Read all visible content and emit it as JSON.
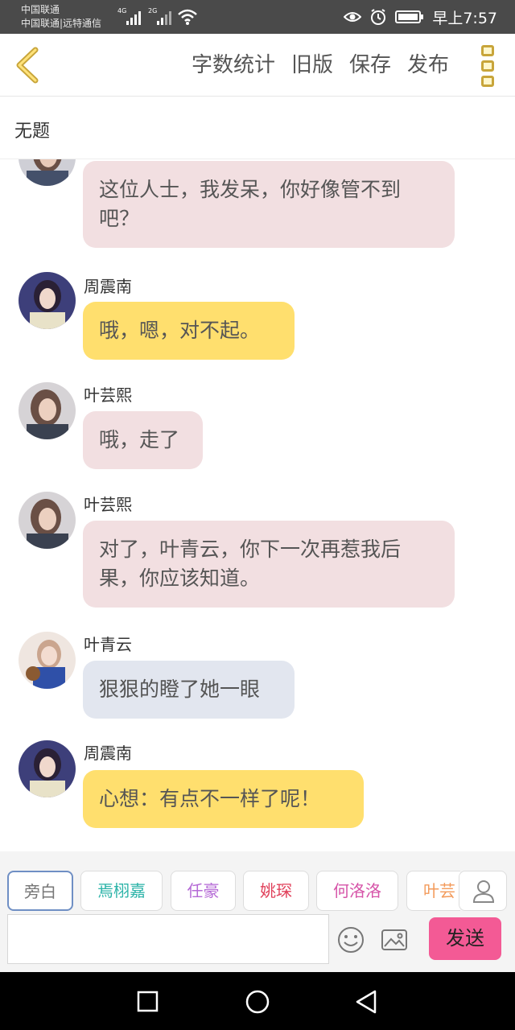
{
  "status_bar": {
    "carrier_line1": "中国联通",
    "carrier_line2": "中国联通|远特通信",
    "network1": "4G",
    "network2": "2G",
    "time": "早上7:57"
  },
  "top_bar": {
    "word_count": "字数统计",
    "old_version": "旧版",
    "save": "保存",
    "publish": "发布"
  },
  "title": "无题",
  "messages": [
    {
      "speaker": "",
      "text": "这位人士，我发呆，你好像管不到吧？",
      "color": "#f2dfe1"
    },
    {
      "speaker": "周震南",
      "text": "哦，嗯，对不起。",
      "color": "#ffdf6e"
    },
    {
      "speaker": "叶芸熙",
      "text": "哦，走了",
      "color": "#f2dfe1"
    },
    {
      "speaker": "叶芸熙",
      "text": "对了，叶青云，你下一次再惹我后果，你应该知道。",
      "color": "#f2dfe1"
    },
    {
      "speaker": "叶青云",
      "text": "狠狠的瞪了她一眼",
      "color": "#e2e6ef"
    },
    {
      "speaker": "周震南",
      "text": "心想：有点不一样了呢！",
      "color": "#ffdf6e"
    }
  ],
  "roles": [
    {
      "label": "旁白",
      "color": "#777777"
    },
    {
      "label": "焉栩嘉",
      "color": "#2bb3a8"
    },
    {
      "label": "任豪",
      "color": "#b56ad6"
    },
    {
      "label": "姚琛",
      "color": "#e0405a"
    },
    {
      "label": "何洛洛",
      "color": "#d653a8"
    },
    {
      "label": "叶芸",
      "color": "#f39a5a"
    }
  ],
  "input": {
    "placeholder": ""
  },
  "send_label": "发送"
}
